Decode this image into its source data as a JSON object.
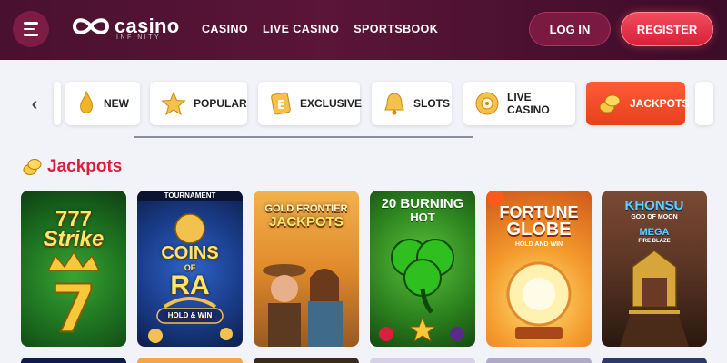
{
  "header": {
    "logo_word": "casino",
    "logo_sub": "INFINITY",
    "nav": [
      "CASINO",
      "LIVE CASINO",
      "SPORTSBOOK"
    ],
    "login_label": "LOG IN",
    "register_label": "REGISTER"
  },
  "categories": [
    {
      "label": "NEW",
      "icon": "flame-icon"
    },
    {
      "label": "POPULAR",
      "icon": "star-icon"
    },
    {
      "label": "EXCLUSIVE",
      "icon": "exclusive-icon"
    },
    {
      "label": "SLOTS",
      "icon": "bell-icon"
    },
    {
      "label": "LIVE CASINO",
      "icon": "roulette-icon"
    },
    {
      "label": "JACKPOTS",
      "icon": "coins-icon"
    }
  ],
  "section": {
    "title": "Jackpots"
  },
  "games": [
    {
      "lines": [
        "777",
        "Strike"
      ]
    },
    {
      "lines": [
        "TOURNAMENT",
        "COINS",
        "OF",
        "RA",
        "HOLD & WIN"
      ]
    },
    {
      "lines": [
        "GOLD FRONTIER",
        "JACKPOTS"
      ]
    },
    {
      "lines": [
        "20 BURNING",
        "HOT"
      ]
    },
    {
      "lines": [
        "FORTUNE",
        "GLOBE",
        "HOLD AND WIN"
      ]
    },
    {
      "lines": [
        "KHONSU",
        "GOD OF MOON",
        "MEGA",
        "FIRE BLAZE"
      ]
    }
  ],
  "colors": {
    "header_bg": "#4a1030",
    "accent_red": "#d8203a",
    "active_category": "#ff5a3a"
  }
}
